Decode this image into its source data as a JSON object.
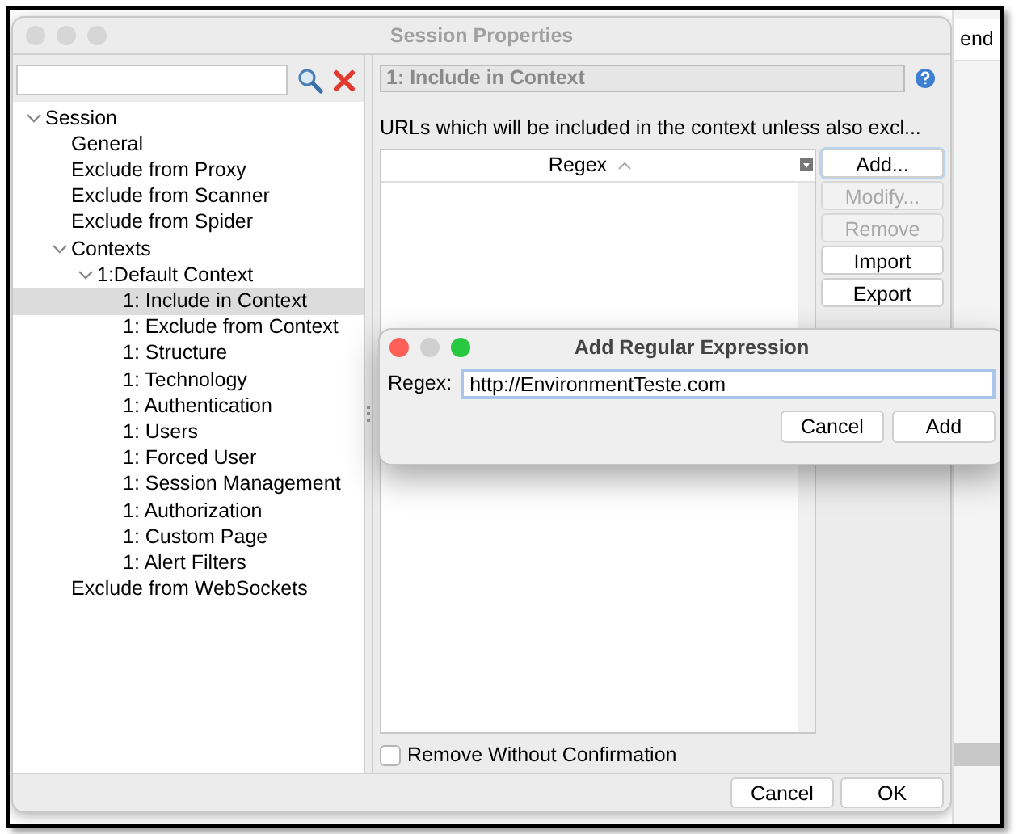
{
  "window": {
    "title": "Session Properties"
  },
  "background_app": {
    "button": "end"
  },
  "tree": [
    {
      "label": "Session",
      "expanded": true,
      "selected": false,
      "children": [
        {
          "label": "General",
          "selected": false
        },
        {
          "label": "Exclude from Proxy",
          "selected": false
        },
        {
          "label": "Exclude from Scanner",
          "selected": false
        },
        {
          "label": "Exclude from Spider",
          "selected": false
        },
        {
          "label": "Contexts",
          "expanded": true,
          "selected": false,
          "children": [
            {
              "label": "1:Default Context",
              "expanded": true,
              "selected": false,
              "children": [
                {
                  "label": "1: Include in Context",
                  "selected": true
                },
                {
                  "label": "1: Exclude from Context",
                  "selected": false
                },
                {
                  "label": "1: Structure",
                  "selected": false
                },
                {
                  "label": "1: Technology",
                  "selected": false
                },
                {
                  "label": "1: Authentication",
                  "selected": false
                },
                {
                  "label": "1: Users",
                  "selected": false
                },
                {
                  "label": "1: Forced User",
                  "selected": false
                },
                {
                  "label": "1: Session Management",
                  "selected": false
                },
                {
                  "label": "1: Authorization",
                  "selected": false
                },
                {
                  "label": "1: Custom Page",
                  "selected": false
                },
                {
                  "label": "1: Alert Filters",
                  "selected": false
                }
              ]
            }
          ]
        },
        {
          "label": "Exclude from WebSockets",
          "selected": false
        }
      ]
    }
  ],
  "panel": {
    "title": "1: Include in Context",
    "description": "URLs which will be included in the context unless also excl...",
    "table": {
      "columns": [
        "Regex"
      ]
    },
    "buttons": [
      {
        "label": "Add...",
        "disabled": false,
        "focused": true
      },
      {
        "label": "Modify...",
        "disabled": true,
        "focused": false
      },
      {
        "label": "Remove",
        "disabled": true,
        "focused": false
      },
      {
        "label": "Import",
        "disabled": false,
        "focused": false
      },
      {
        "label": "Export",
        "disabled": false,
        "focused": false
      }
    ],
    "checkbox": {
      "label": "Remove Without Confirmation",
      "checked": false
    }
  },
  "footer_buttons": [
    "Cancel",
    "OK"
  ],
  "dialog": {
    "title": "Add Regular Expression",
    "field_label": "Regex:",
    "value": "http://EnvironmentTeste.com",
    "buttons": [
      "Cancel",
      "Add"
    ]
  }
}
